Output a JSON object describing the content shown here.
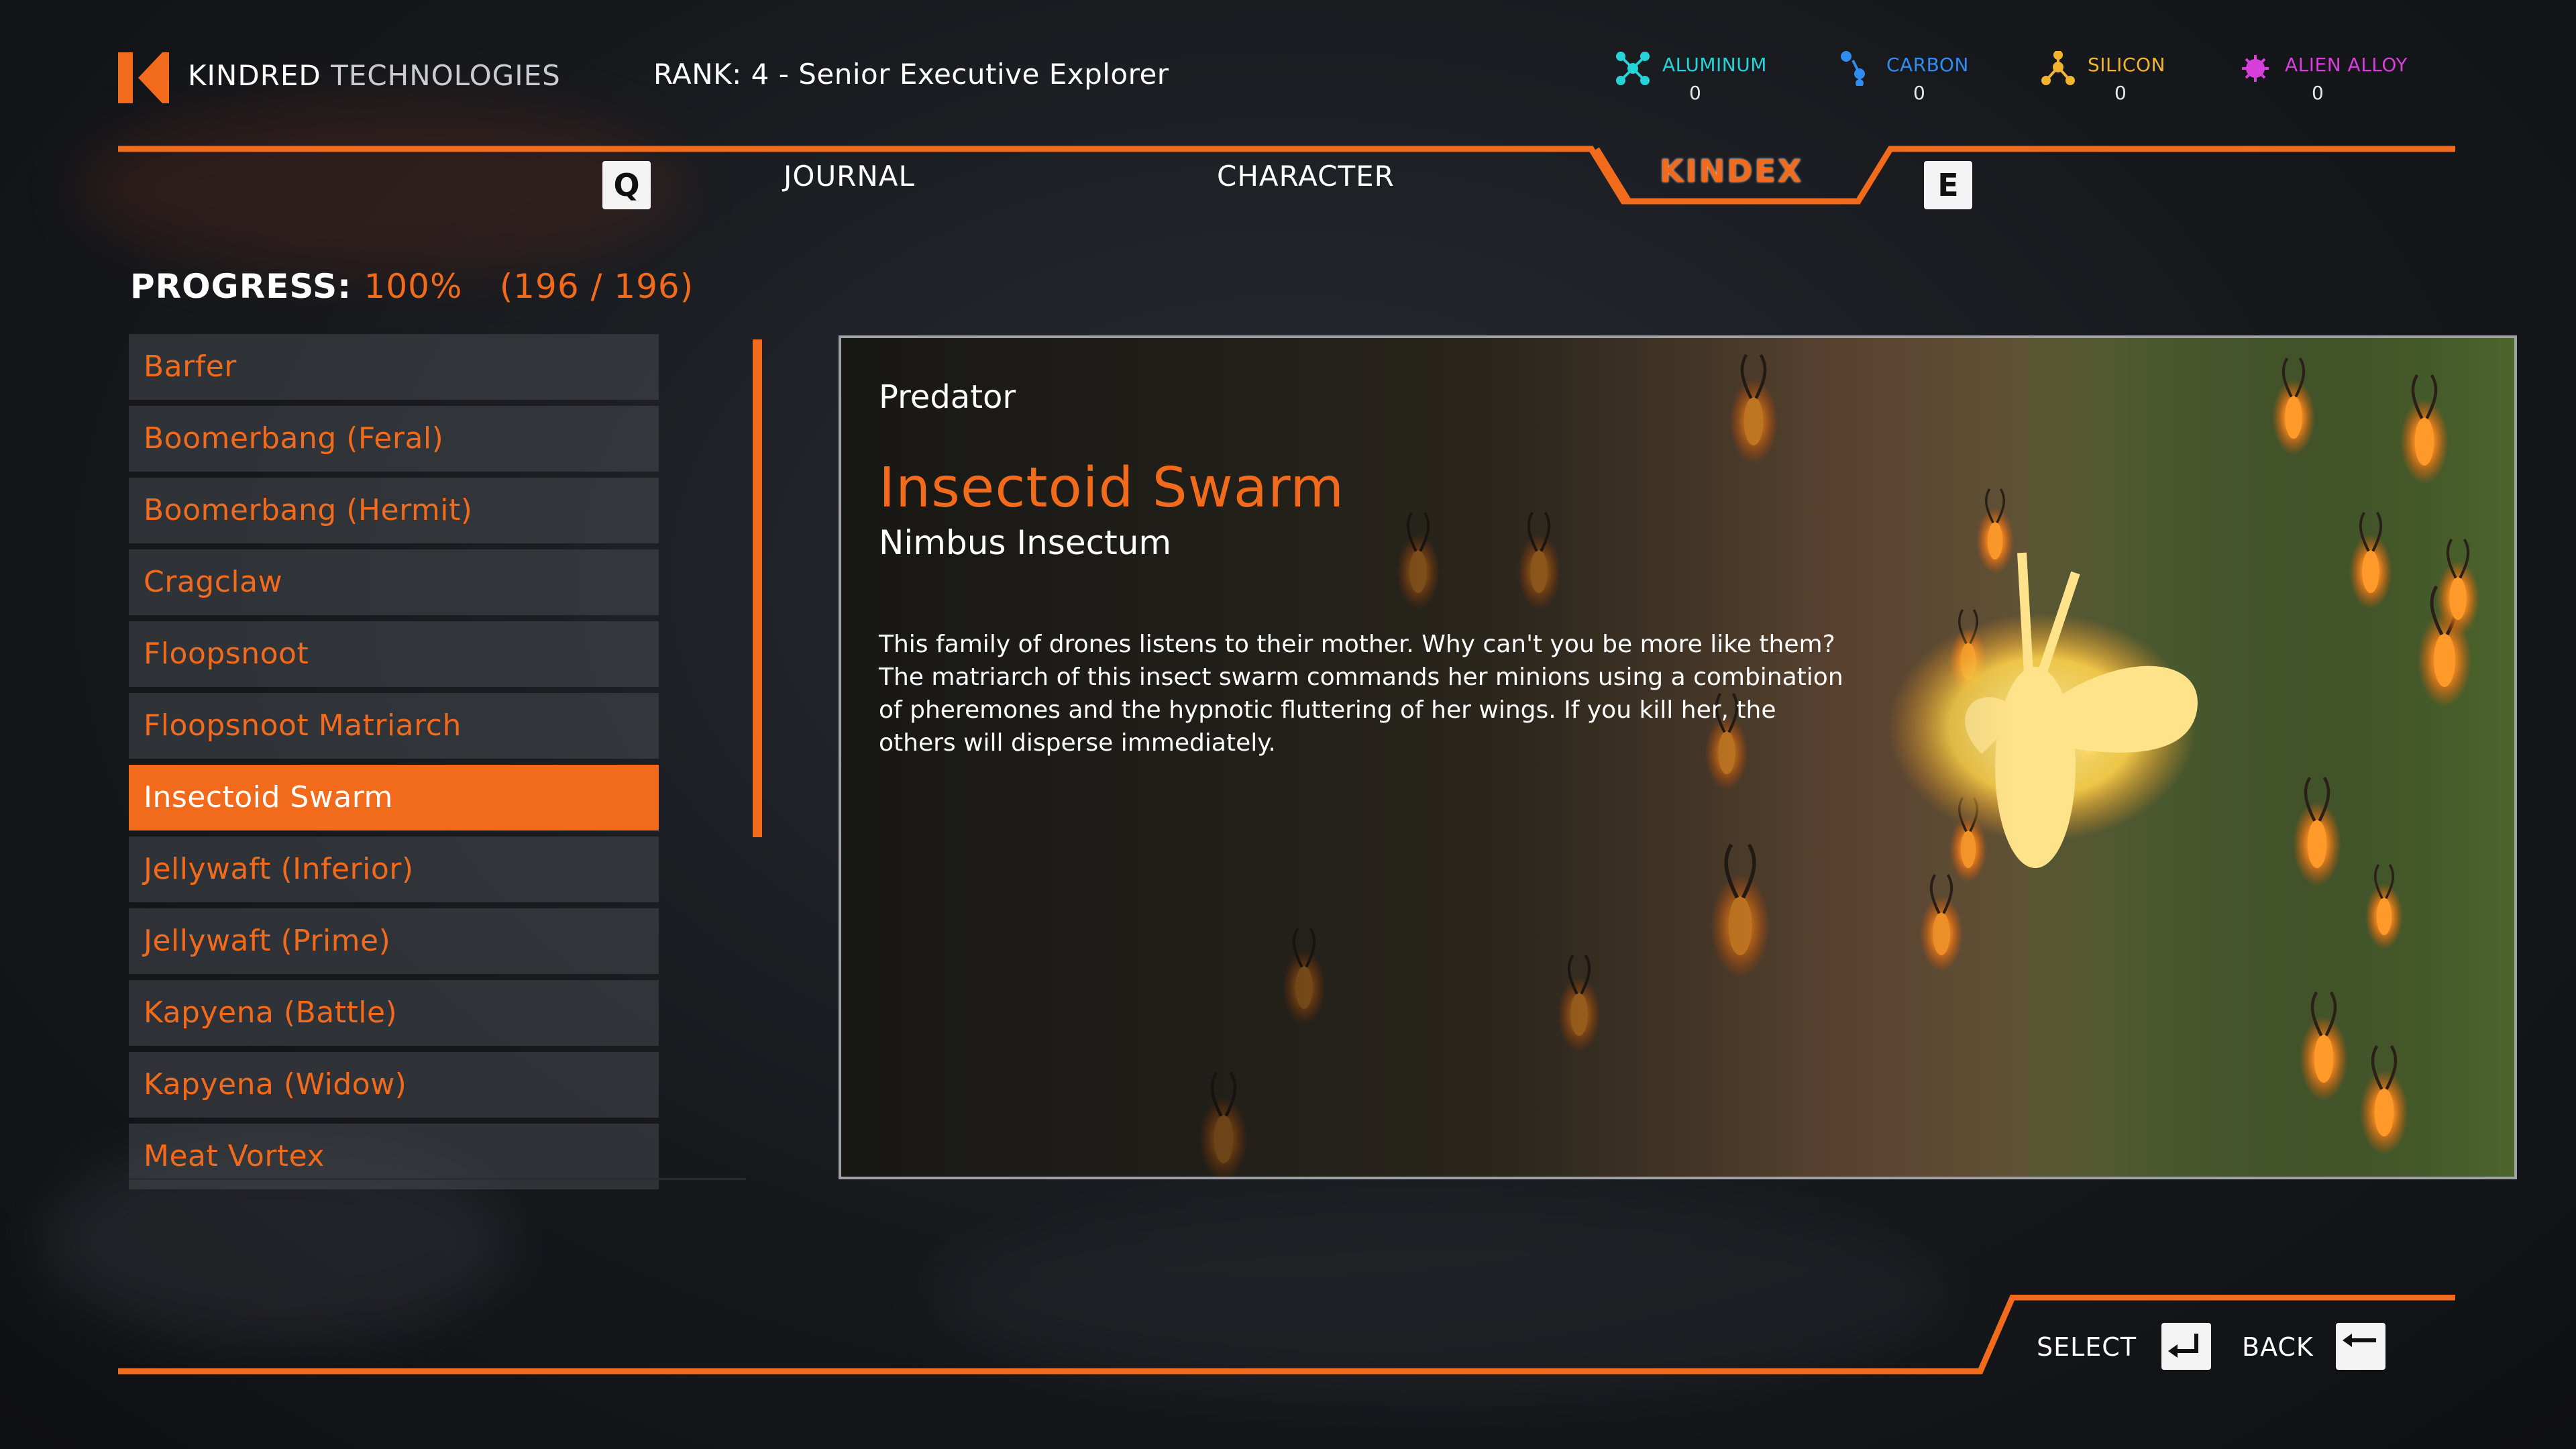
{
  "header": {
    "brand_primary": "KINDRED",
    "brand_secondary": "TECHNOLOGIES",
    "rank": "RANK: 4 - Senior Executive Explorer"
  },
  "resources": [
    {
      "name": "ALUMINUM",
      "value": "0",
      "color": "#25d3d8",
      "icon": "aluminum-icon"
    },
    {
      "name": "CARBON",
      "value": "0",
      "color": "#2f8cf0",
      "icon": "carbon-icon"
    },
    {
      "name": "SILICON",
      "value": "0",
      "color": "#f2b42e",
      "icon": "silicon-icon"
    },
    {
      "name": "ALIEN ALLOY",
      "value": "0",
      "color": "#d63fd9",
      "icon": "alien-alloy-icon"
    }
  ],
  "tabs": {
    "prev_key": "Q",
    "next_key": "E",
    "items": [
      {
        "label": "JOURNAL",
        "active": false
      },
      {
        "label": "CHARACTER",
        "active": false
      },
      {
        "label": "KINDEX",
        "active": true
      }
    ]
  },
  "progress": {
    "label": "PROGRESS:",
    "percent": "100%",
    "count": "(196 / 196)"
  },
  "list": {
    "items": [
      "Barfer",
      "Boomerbang (Feral)",
      "Boomerbang (Hermit)",
      "Cragclaw",
      "Floopsnoot",
      "Floopsnoot Matriarch",
      "Insectoid Swarm",
      "Jellywaft (Inferior)",
      "Jellywaft (Prime)",
      "Kapyena (Battle)",
      "Kapyena (Widow)",
      "Meat Vortex"
    ],
    "selected_index": 6
  },
  "detail": {
    "category": "Predator",
    "title": "Insectoid Swarm",
    "scientific_name": "Nimbus Insectum",
    "description": "This family of drones listens to their mother. Why can't you be more like them? The matriarch of this insect swarm commands her minions using a combination of pheremones and the hypnotic fluttering of her wings. If you kill her, the others will disperse immediately."
  },
  "footer": {
    "select_label": "SELECT",
    "back_label": "BACK"
  },
  "colors": {
    "accent": "#f26a1b",
    "panel_border": "#9ea1a6"
  }
}
